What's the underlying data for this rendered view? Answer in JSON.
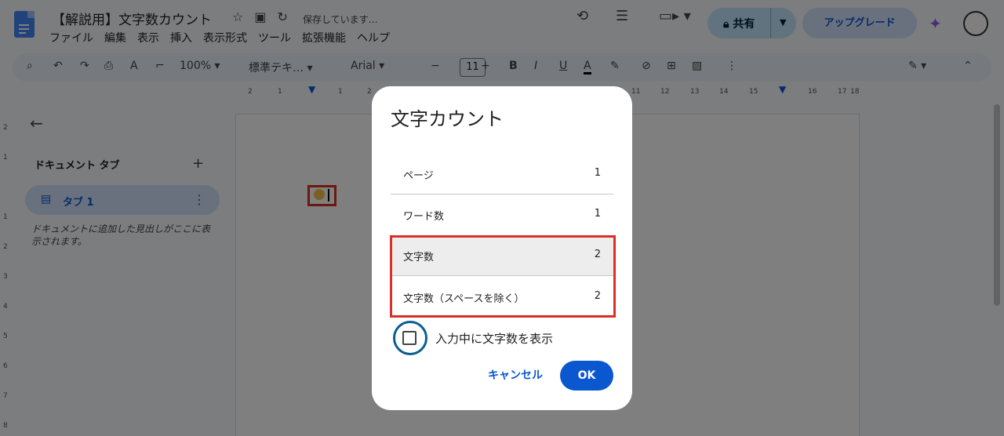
{
  "app": {
    "title": "【解説用】文字数カウント",
    "saving_status": "保存しています…",
    "menu": [
      "ファイル",
      "編集",
      "表示",
      "挿入",
      "表示形式",
      "ツール",
      "拡張機能",
      "ヘルプ"
    ],
    "share_label": "共有",
    "upgrade_label": "アップグレード"
  },
  "toolbar": {
    "zoom": "100%",
    "style": "標準テキ…",
    "font": "Arial",
    "font_size": "11"
  },
  "ruler": {
    "top_ticks": [
      "2",
      "1",
      "1",
      "2",
      "11",
      "12",
      "13",
      "14",
      "15",
      "16",
      "17",
      "18"
    ],
    "left_ticks": [
      "2",
      "1",
      "1",
      "2",
      "3",
      "4",
      "5",
      "6",
      "7",
      "8"
    ]
  },
  "sidebar": {
    "heading": "ドキュメント タブ",
    "tab_label": "タブ 1",
    "hint": "ドキュメントに追加した見出しがここに表示されます。"
  },
  "dialog": {
    "title": "文字カウント",
    "rows": [
      {
        "label": "ページ",
        "value": "1"
      },
      {
        "label": "ワード数",
        "value": "1"
      },
      {
        "label": "文字数",
        "value": "2"
      },
      {
        "label": "文字数（スペースを除く）",
        "value": "2"
      }
    ],
    "checkbox_label": "入力中に文字数を表示",
    "cancel_label": "キャンセル",
    "ok_label": "OK"
  },
  "colors": {
    "accent": "#0b57d0",
    "highlight_frame": "#d93025",
    "focus_ring": "#0b5e8f"
  }
}
